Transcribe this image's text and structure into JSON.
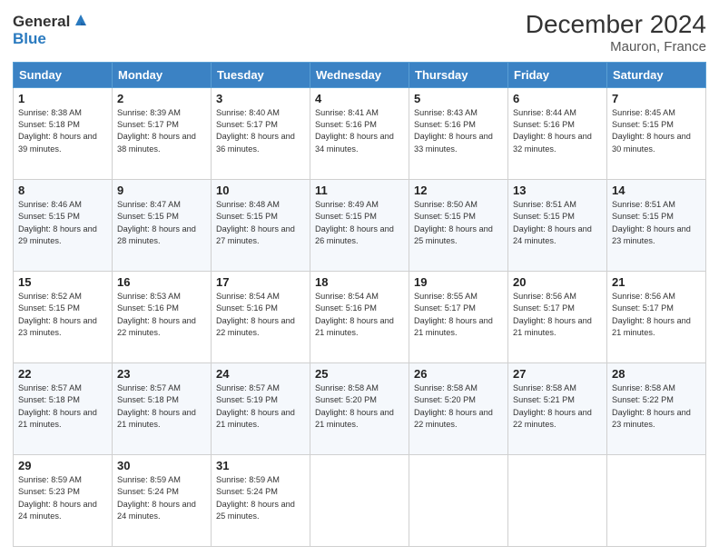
{
  "header": {
    "logo_general": "General",
    "logo_blue": "Blue",
    "month_title": "December 2024",
    "location": "Mauron, France"
  },
  "weekdays": [
    "Sunday",
    "Monday",
    "Tuesday",
    "Wednesday",
    "Thursday",
    "Friday",
    "Saturday"
  ],
  "weeks": [
    [
      {
        "day": "1",
        "sunrise": "Sunrise: 8:38 AM",
        "sunset": "Sunset: 5:18 PM",
        "daylight": "Daylight: 8 hours and 39 minutes."
      },
      {
        "day": "2",
        "sunrise": "Sunrise: 8:39 AM",
        "sunset": "Sunset: 5:17 PM",
        "daylight": "Daylight: 8 hours and 38 minutes."
      },
      {
        "day": "3",
        "sunrise": "Sunrise: 8:40 AM",
        "sunset": "Sunset: 5:17 PM",
        "daylight": "Daylight: 8 hours and 36 minutes."
      },
      {
        "day": "4",
        "sunrise": "Sunrise: 8:41 AM",
        "sunset": "Sunset: 5:16 PM",
        "daylight": "Daylight: 8 hours and 34 minutes."
      },
      {
        "day": "5",
        "sunrise": "Sunrise: 8:43 AM",
        "sunset": "Sunset: 5:16 PM",
        "daylight": "Daylight: 8 hours and 33 minutes."
      },
      {
        "day": "6",
        "sunrise": "Sunrise: 8:44 AM",
        "sunset": "Sunset: 5:16 PM",
        "daylight": "Daylight: 8 hours and 32 minutes."
      },
      {
        "day": "7",
        "sunrise": "Sunrise: 8:45 AM",
        "sunset": "Sunset: 5:15 PM",
        "daylight": "Daylight: 8 hours and 30 minutes."
      }
    ],
    [
      {
        "day": "8",
        "sunrise": "Sunrise: 8:46 AM",
        "sunset": "Sunset: 5:15 PM",
        "daylight": "Daylight: 8 hours and 29 minutes."
      },
      {
        "day": "9",
        "sunrise": "Sunrise: 8:47 AM",
        "sunset": "Sunset: 5:15 PM",
        "daylight": "Daylight: 8 hours and 28 minutes."
      },
      {
        "day": "10",
        "sunrise": "Sunrise: 8:48 AM",
        "sunset": "Sunset: 5:15 PM",
        "daylight": "Daylight: 8 hours and 27 minutes."
      },
      {
        "day": "11",
        "sunrise": "Sunrise: 8:49 AM",
        "sunset": "Sunset: 5:15 PM",
        "daylight": "Daylight: 8 hours and 26 minutes."
      },
      {
        "day": "12",
        "sunrise": "Sunrise: 8:50 AM",
        "sunset": "Sunset: 5:15 PM",
        "daylight": "Daylight: 8 hours and 25 minutes."
      },
      {
        "day": "13",
        "sunrise": "Sunrise: 8:51 AM",
        "sunset": "Sunset: 5:15 PM",
        "daylight": "Daylight: 8 hours and 24 minutes."
      },
      {
        "day": "14",
        "sunrise": "Sunrise: 8:51 AM",
        "sunset": "Sunset: 5:15 PM",
        "daylight": "Daylight: 8 hours and 23 minutes."
      }
    ],
    [
      {
        "day": "15",
        "sunrise": "Sunrise: 8:52 AM",
        "sunset": "Sunset: 5:15 PM",
        "daylight": "Daylight: 8 hours and 23 minutes."
      },
      {
        "day": "16",
        "sunrise": "Sunrise: 8:53 AM",
        "sunset": "Sunset: 5:16 PM",
        "daylight": "Daylight: 8 hours and 22 minutes."
      },
      {
        "day": "17",
        "sunrise": "Sunrise: 8:54 AM",
        "sunset": "Sunset: 5:16 PM",
        "daylight": "Daylight: 8 hours and 22 minutes."
      },
      {
        "day": "18",
        "sunrise": "Sunrise: 8:54 AM",
        "sunset": "Sunset: 5:16 PM",
        "daylight": "Daylight: 8 hours and 21 minutes."
      },
      {
        "day": "19",
        "sunrise": "Sunrise: 8:55 AM",
        "sunset": "Sunset: 5:17 PM",
        "daylight": "Daylight: 8 hours and 21 minutes."
      },
      {
        "day": "20",
        "sunrise": "Sunrise: 8:56 AM",
        "sunset": "Sunset: 5:17 PM",
        "daylight": "Daylight: 8 hours and 21 minutes."
      },
      {
        "day": "21",
        "sunrise": "Sunrise: 8:56 AM",
        "sunset": "Sunset: 5:17 PM",
        "daylight": "Daylight: 8 hours and 21 minutes."
      }
    ],
    [
      {
        "day": "22",
        "sunrise": "Sunrise: 8:57 AM",
        "sunset": "Sunset: 5:18 PM",
        "daylight": "Daylight: 8 hours and 21 minutes."
      },
      {
        "day": "23",
        "sunrise": "Sunrise: 8:57 AM",
        "sunset": "Sunset: 5:18 PM",
        "daylight": "Daylight: 8 hours and 21 minutes."
      },
      {
        "day": "24",
        "sunrise": "Sunrise: 8:57 AM",
        "sunset": "Sunset: 5:19 PM",
        "daylight": "Daylight: 8 hours and 21 minutes."
      },
      {
        "day": "25",
        "sunrise": "Sunrise: 8:58 AM",
        "sunset": "Sunset: 5:20 PM",
        "daylight": "Daylight: 8 hours and 21 minutes."
      },
      {
        "day": "26",
        "sunrise": "Sunrise: 8:58 AM",
        "sunset": "Sunset: 5:20 PM",
        "daylight": "Daylight: 8 hours and 22 minutes."
      },
      {
        "day": "27",
        "sunrise": "Sunrise: 8:58 AM",
        "sunset": "Sunset: 5:21 PM",
        "daylight": "Daylight: 8 hours and 22 minutes."
      },
      {
        "day": "28",
        "sunrise": "Sunrise: 8:58 AM",
        "sunset": "Sunset: 5:22 PM",
        "daylight": "Daylight: 8 hours and 23 minutes."
      }
    ],
    [
      {
        "day": "29",
        "sunrise": "Sunrise: 8:59 AM",
        "sunset": "Sunset: 5:23 PM",
        "daylight": "Daylight: 8 hours and 24 minutes."
      },
      {
        "day": "30",
        "sunrise": "Sunrise: 8:59 AM",
        "sunset": "Sunset: 5:24 PM",
        "daylight": "Daylight: 8 hours and 24 minutes."
      },
      {
        "day": "31",
        "sunrise": "Sunrise: 8:59 AM",
        "sunset": "Sunset: 5:24 PM",
        "daylight": "Daylight: 8 hours and 25 minutes."
      },
      null,
      null,
      null,
      null
    ]
  ]
}
